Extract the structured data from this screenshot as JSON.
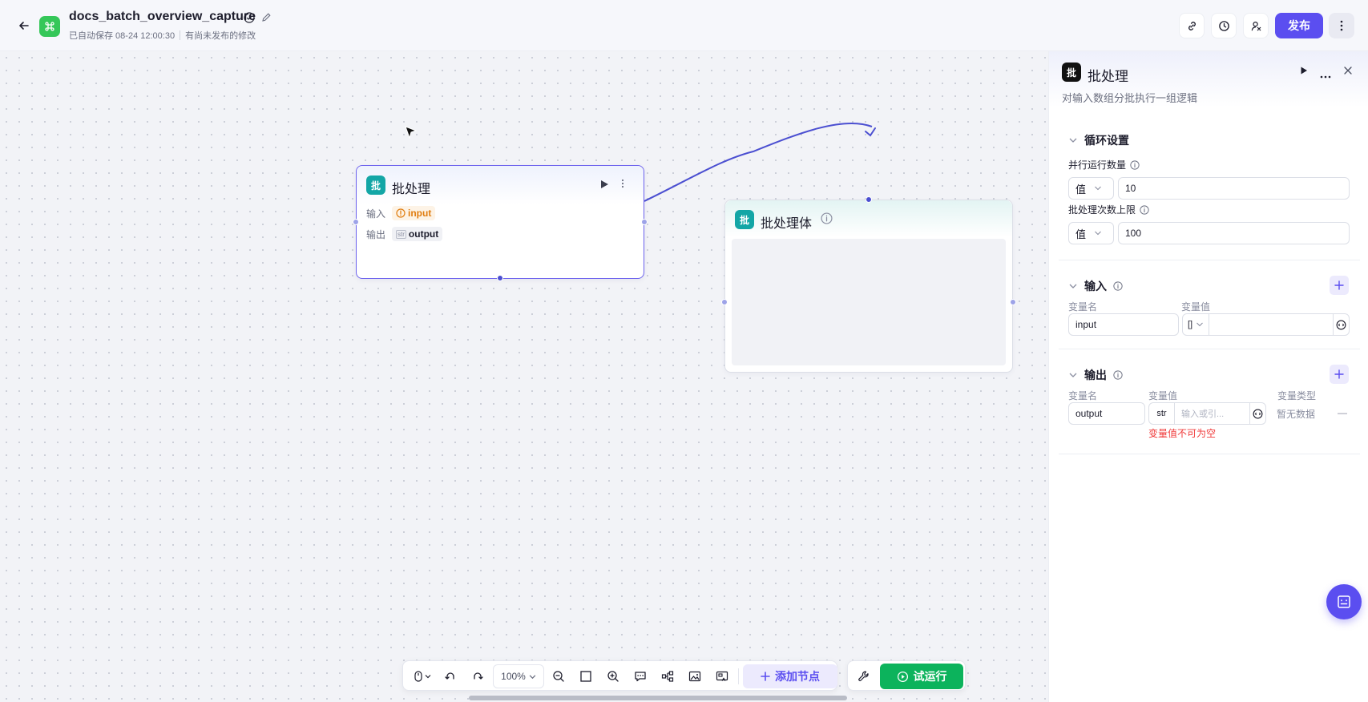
{
  "header": {
    "title": "docs_batch_overview_capture",
    "autosave": "已自动保存 08-24 12:00:30",
    "unpublished": "有尚未发布的修改",
    "publish_label": "发布"
  },
  "canvas": {
    "node_batch": {
      "icon_text": "批",
      "title": "批处理",
      "input_label": "输入",
      "input_tag": "input",
      "output_label": "输出",
      "output_type_icon": "str",
      "output_tag": "output"
    },
    "node_body": {
      "icon_text": "批",
      "title": "批处理体"
    }
  },
  "toolbar": {
    "zoom": "100%",
    "add_node_label": "添加节点",
    "trial_run_label": "试运行"
  },
  "panel": {
    "icon_text": "批",
    "title": "批处理",
    "description": "对输入数组分批执行一组逻辑",
    "loop_section": {
      "title": "循环设置",
      "parallel_label": "并行运行数量",
      "parallel_mode": "值",
      "parallel_value": "10",
      "limit_label": "批处理次数上限",
      "limit_mode": "值",
      "limit_value": "100"
    },
    "input_section": {
      "title": "输入",
      "col_name": "变量名",
      "col_value": "变量值",
      "var_name": "input",
      "var_type": "[]"
    },
    "output_section": {
      "title": "输出",
      "col_name": "变量名",
      "col_value": "变量值",
      "col_type": "变量类型",
      "var_name": "output",
      "var_type": "str",
      "value_placeholder": "输入或引...",
      "type_value": "暂无数据",
      "remove": "—",
      "error": "变量值不可为空"
    }
  },
  "colors": {
    "accent": "#5b4ef0",
    "node_icon": "#13a6a6",
    "success": "#0cb35c",
    "warning": "#e07d10",
    "error": "#f03a3a",
    "edge": "#4b4fd1"
  }
}
